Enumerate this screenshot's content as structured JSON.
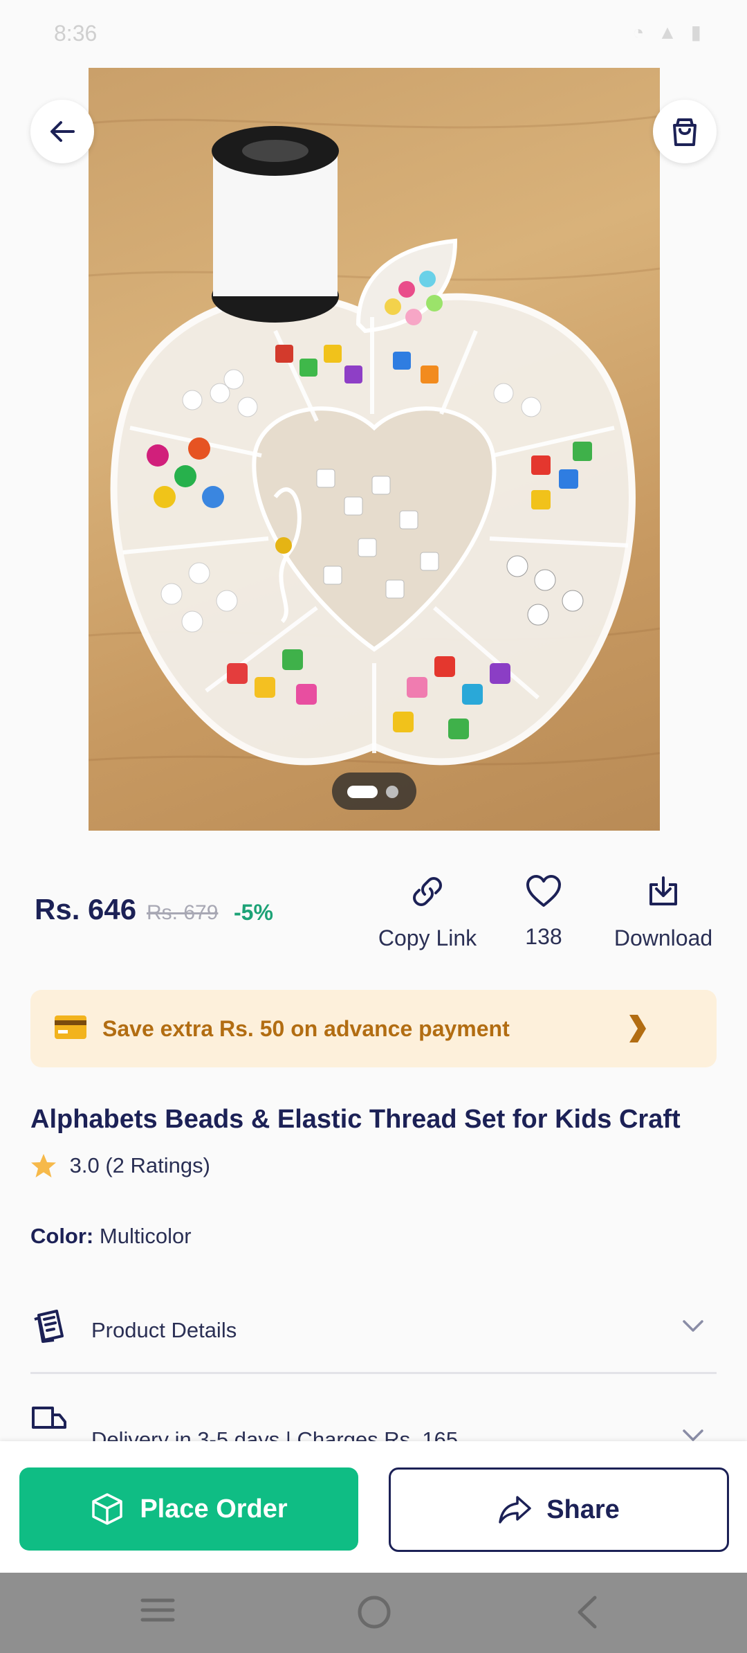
{
  "status_bar": {
    "time": "8:36",
    "right_icons": "signal wifi battery 83%"
  },
  "gallery": {
    "image_description": "apple-shaped-bead-organizer",
    "page_count": 2,
    "active_page": 1
  },
  "pricing": {
    "price": "Rs. 646",
    "mrp": "Rs. 679",
    "discount": "-5%"
  },
  "actions": {
    "copy_link": "Copy Link",
    "likes": "138",
    "download": "Download"
  },
  "offer": {
    "text": "Save extra Rs. 50 on advance payment"
  },
  "product": {
    "title": "Alphabets Beads & Elastic Thread Set for Kids Craft",
    "rating": "3.0 (2 Ratings)",
    "color_label": "Color:",
    "color_value": "Multicolor"
  },
  "sections": {
    "details": "Product Details",
    "delivery": "Delivery in 3-5 days | Charges Rs. 165"
  },
  "buttons": {
    "place_order": "Place Order",
    "share": "Share"
  },
  "colors": {
    "accent_green": "#0fbd84",
    "navy": "#1c2156",
    "offer_bg": "#fdf0db",
    "offer_text": "#b26d12"
  }
}
